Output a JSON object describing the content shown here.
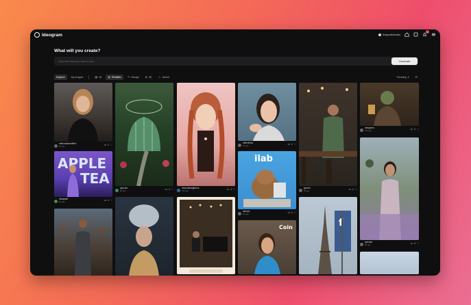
{
  "app": {
    "name": "Ideogram"
  },
  "topbar": {
    "username": "thegoodtutorials",
    "notif_count": "11"
  },
  "hero": {
    "title": "What will you create?",
    "placeholder": "Describe what you want to see",
    "generate_label": "Generate"
  },
  "filters": {
    "tabs": [
      {
        "label": "Explore"
      },
      {
        "label": "My images"
      }
    ],
    "chips": [
      {
        "label": "All",
        "icon": "grid-icon"
      },
      {
        "label": "Realistic",
        "icon": "camera-icon"
      },
      {
        "label": "Design",
        "icon": "pen-icon"
      },
      {
        "label": "3D",
        "icon": "cube-icon"
      },
      {
        "label": "Anime",
        "icon": "smile-icon"
      }
    ],
    "sort_label": "Trending"
  },
  "colors": {
    "window_bg": "#0f0f10",
    "accent_badge": "#e0334b"
  },
  "images": [
    {
      "id": "a",
      "user": "marionsaranoffice",
      "time": "8h ago",
      "likes": "2"
    },
    {
      "id": "b",
      "user": "",
      "time": "",
      "likes": ""
    },
    {
      "id": "c",
      "user": "mumofstraightens",
      "time": "15h ago",
      "likes": "4"
    },
    {
      "id": "d",
      "user": "mikenhello",
      "time": "2h ago",
      "likes": "4"
    },
    {
      "id": "e",
      "user": "gnome",
      "time": "3h ago",
      "likes": "4"
    },
    {
      "id": "f",
      "user": "designers",
      "time": "15h ago",
      "likes": "4"
    },
    {
      "id": "g",
      "user": "nikawash",
      "time": "9h ago",
      "likes": "4"
    },
    {
      "id": "h",
      "user": "",
      "time": "",
      "likes": ""
    },
    {
      "id": "i",
      "user": "dannyo",
      "time": "3h ago",
      "likes": "4"
    },
    {
      "id": "j",
      "user": "apxcola",
      "time": "8h ago",
      "likes": "4"
    },
    {
      "id": "k",
      "user": "",
      "time": "",
      "likes": ""
    }
  ],
  "overlay_text": {
    "apple": "APPLE",
    "tea": "TEA",
    "ilab": "ilab",
    "coin": "Coin"
  }
}
